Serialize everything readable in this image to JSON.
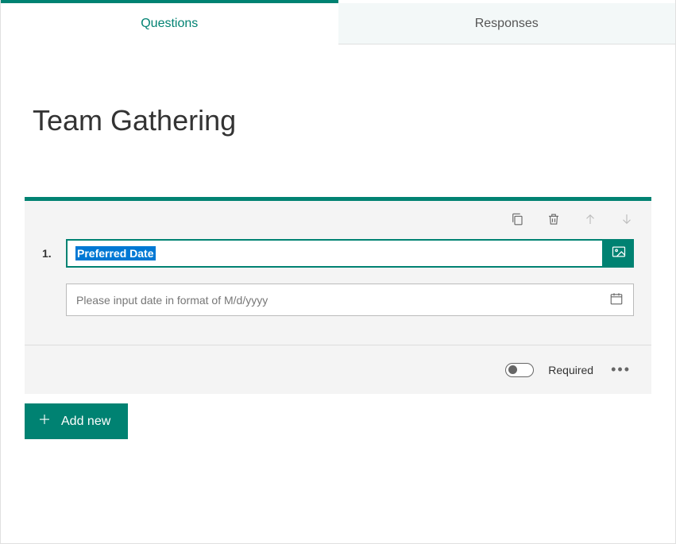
{
  "tabs": {
    "questions": "Questions",
    "responses": "Responses"
  },
  "form": {
    "title": "Team Gathering"
  },
  "question": {
    "number": "1.",
    "text": "Preferred Date",
    "date_placeholder": "Please input date in format of M/d/yyyy",
    "required_label": "Required"
  },
  "buttons": {
    "add_new": "Add new"
  }
}
